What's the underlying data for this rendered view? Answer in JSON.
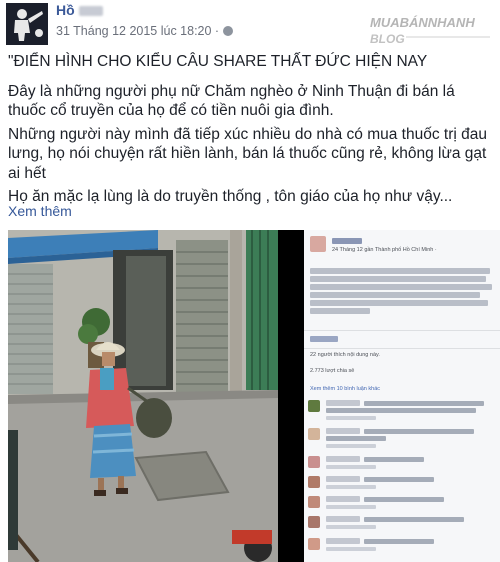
{
  "post": {
    "author": "Hồ",
    "timestamp": "31 Tháng 12 2015 lúc 18:20 ·",
    "watermark": "MUABANNHANH BLOG",
    "paragraphs": [
      "\"ĐIỂN HÌNH CHO KIỂU CÂU SHARE THẤT ĐỨC HIỆN NAY",
      "Đây là những người phụ nữ Chăm nghèo ở Ninh Thuận đi bán lá thuốc cổ truyền của họ để có tiền nuôi gia đình.",
      "Những người này mình đã tiếp xúc nhiều do nhà có mua thuốc trị đau lưng, họ nói chuyện rất hiền lành, bán lá thuốc cũng rẻ, không lừa gạt ai hết",
      "Họ ăn mặc lạ lùng là do truyền thống , tôn giáo của họ như vậy..."
    ],
    "see_more": "Xem thêm"
  },
  "screenshot": {
    "meta": "24 Tháng 12 gần Thành phố Hồ Chí Minh ·",
    "likes": "22 người thích nội dung này.",
    "shares": "2.773 lượt chia sẻ",
    "comments_link": "Xem thêm 10 bình luận khác"
  },
  "colors": {
    "link": "#365899",
    "author": "#3b5998",
    "text": "#1d2129",
    "meta": "#6a6f7a"
  }
}
